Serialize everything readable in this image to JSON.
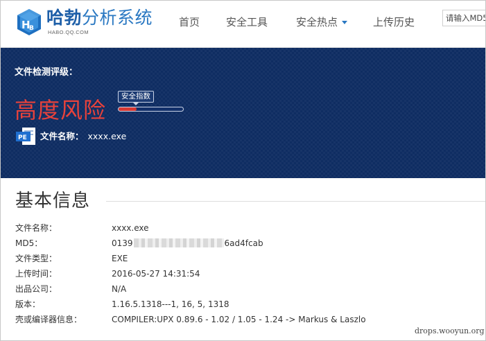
{
  "header": {
    "brand": "哈勃",
    "title_rest": "分析系统",
    "subtitle": "HABO.QQ.COM",
    "nav": [
      {
        "label": "首页",
        "has_dropdown": false
      },
      {
        "label": "安全工具",
        "has_dropdown": false
      },
      {
        "label": "安全热点",
        "has_dropdown": true
      },
      {
        "label": "上传历史",
        "has_dropdown": false
      }
    ],
    "search_placeholder": "请输入MD5",
    "colors": {
      "brand": "#1e5fa8",
      "accent": "#2a78c2"
    }
  },
  "banner": {
    "label": "文件检测评级：",
    "risk_level": "高度风险",
    "score_label": "安全指数",
    "score_fraction": 0.28,
    "file_icon": "PE",
    "file_name_key": "文件名称：",
    "file_name_value": "xxxx.exe",
    "colors": {
      "background": "#0f2d62",
      "risk": "#e8423b"
    }
  },
  "basic_info": {
    "title": "基本信息",
    "rows": [
      {
        "key": "文件名称：",
        "value": "xxxx.exe"
      },
      {
        "key": "MD5：",
        "value_start": "0139",
        "value_end": "6ad4fcab"
      },
      {
        "key": "文件类型：",
        "value": "EXE"
      },
      {
        "key": "上传时间：",
        "value": "2016-05-27 14:31:54"
      },
      {
        "key": "出品公司：",
        "value": "N/A"
      },
      {
        "key": "版本：",
        "value": "1.16.5.1318---1, 16, 5, 1318"
      },
      {
        "key": "壳或编译器信息：",
        "value": "COMPILER:UPX 0.89.6 - 1.02 / 1.05 - 1.24 -> Markus & Laszlo"
      }
    ]
  },
  "watermark": "drops.wooyun.org"
}
